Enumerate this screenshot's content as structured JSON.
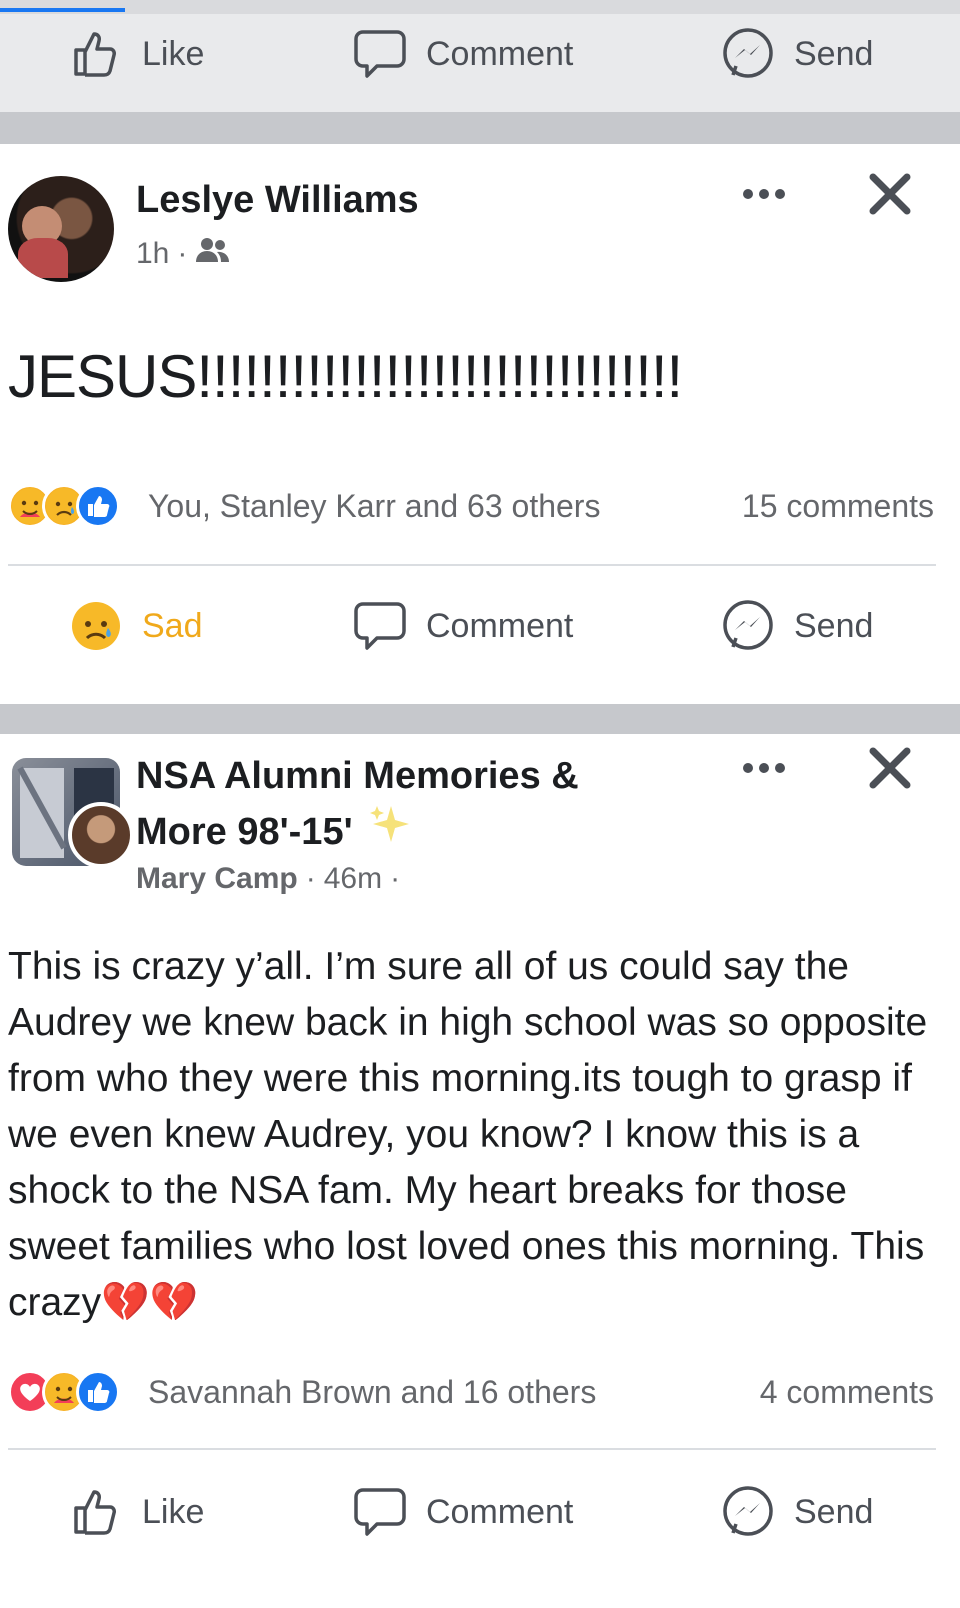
{
  "top_actions": {
    "like": "Like",
    "comment": "Comment",
    "send": "Send"
  },
  "post1": {
    "author": "Leslye Williams",
    "time": "1h",
    "audience_icon": "friends-icon",
    "text": "JESUS!!!!!!!!!!!!!!!!!!!!!!!!!!!!!!!",
    "reactions": [
      "care-emoji",
      "sad-emoji",
      "like-emoji"
    ],
    "reactions_text": "You, Stanley Karr and 63 others",
    "comments": "15 comments",
    "actions": {
      "reaction": "Sad",
      "comment": "Comment",
      "send": "Send"
    }
  },
  "post2": {
    "group_name_line1": "NSA Alumni Memories &",
    "group_name_line2": "More 98'-15'",
    "author": "Mary Camp",
    "time": "46m",
    "text": "This is crazy y’all. I’m sure all of us could say the Audrey we knew back in high school was so opposite from who they were this morning.its tough to grasp if we even knew Audrey, you know? I know this is a shock to the NSA fam. My heart breaks for those sweet families who lost loved ones this morning. This crazy💔💔",
    "reactions": [
      "love-emoji",
      "care-emoji",
      "like-emoji"
    ],
    "reactions_text": "Savannah Brown and 16 others",
    "comments": "4 comments",
    "actions": {
      "like": "Like",
      "comment": "Comment",
      "send": "Send"
    }
  },
  "colors": {
    "accent": "#1877f2",
    "sad": "#f0a91b",
    "love": "#f33e58",
    "muted": "#65676b"
  },
  "top_progress": 0.13
}
